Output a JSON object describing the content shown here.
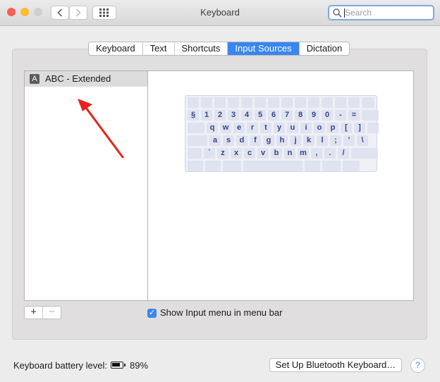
{
  "window": {
    "title": "Keyboard"
  },
  "toolbar": {
    "search_placeholder": "Search"
  },
  "tabs": [
    {
      "label": "Keyboard",
      "active": false
    },
    {
      "label": "Text",
      "active": false
    },
    {
      "label": "Shortcuts",
      "active": false
    },
    {
      "label": "Input Sources",
      "active": true
    },
    {
      "label": "Dictation",
      "active": false
    }
  ],
  "input_sources": {
    "items": [
      {
        "icon_letter": "A",
        "label": "ABC - Extended",
        "selected": true
      }
    ]
  },
  "keyboard_preview": {
    "rows": [
      [
        "",
        "",
        "",
        "",
        "",
        "",
        "",
        "",
        "",
        "",
        "",
        "",
        "",
        ""
      ],
      [
        "§",
        "1",
        "2",
        "3",
        "4",
        "5",
        "6",
        "7",
        "8",
        "9",
        "0",
        "-",
        "=",
        ""
      ],
      [
        "",
        "q",
        "w",
        "e",
        "r",
        "t",
        "y",
        "u",
        "i",
        "o",
        "p",
        "[",
        "]",
        ""
      ],
      [
        "",
        "a",
        "s",
        "d",
        "f",
        "g",
        "h",
        "j",
        "k",
        "l",
        ";",
        "'",
        "\\"
      ],
      [
        "",
        "`",
        "z",
        "x",
        "c",
        "v",
        "b",
        "n",
        "m",
        ",",
        ".",
        "/",
        ""
      ],
      [
        "",
        "",
        "",
        "",
        "",
        "",
        ""
      ]
    ]
  },
  "controls": {
    "add_label": "+",
    "remove_label": "−",
    "show_input_menu": {
      "label": "Show Input menu in menu bar",
      "checked": true
    }
  },
  "footer": {
    "battery_label": "Keyboard battery level:",
    "battery_level": 0.89,
    "battery_percent": "89%",
    "bluetooth_button": "Set Up Bluetooth Keyboard…",
    "help_label": "?"
  },
  "colors": {
    "accent": "#3a86f0",
    "annotation_arrow": "#e8211d",
    "key_text": "#34458a"
  }
}
